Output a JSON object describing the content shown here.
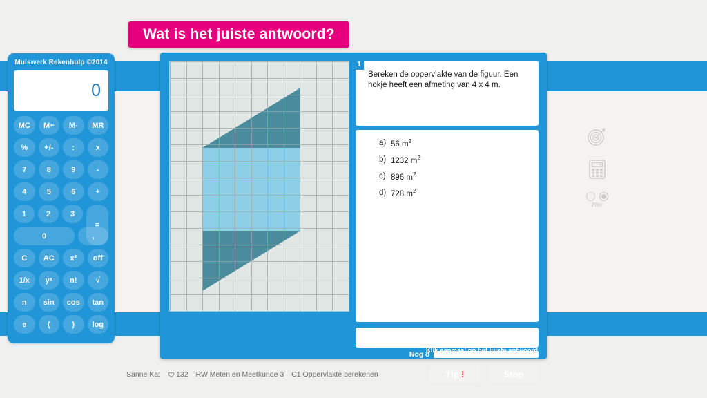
{
  "banner": {
    "title": "Wat is het juiste antwoord?"
  },
  "calculator": {
    "title": "Muiswerk Rekenhulp ©2014",
    "display_value": "0",
    "rows": [
      {
        "keys": [
          {
            "label": "MC",
            "name": "calc-key-mc"
          },
          {
            "label": "M+",
            "name": "calc-key-m-plus"
          },
          {
            "label": "M-",
            "name": "calc-key-m-minus"
          },
          {
            "label": "MR",
            "name": "calc-key-mr"
          }
        ]
      },
      {
        "keys": [
          {
            "label": "%",
            "name": "calc-key-percent"
          },
          {
            "label": "+/-",
            "name": "calc-key-sign"
          },
          {
            "label": ":",
            "name": "calc-key-divide"
          },
          {
            "label": "x",
            "name": "calc-key-multiply"
          }
        ]
      },
      {
        "keys": [
          {
            "label": "7",
            "name": "calc-key-7"
          },
          {
            "label": "8",
            "name": "calc-key-8"
          },
          {
            "label": "9",
            "name": "calc-key-9"
          },
          {
            "label": "-",
            "name": "calc-key-subtract"
          }
        ]
      },
      {
        "keys": [
          {
            "label": "4",
            "name": "calc-key-4"
          },
          {
            "label": "5",
            "name": "calc-key-5"
          },
          {
            "label": "6",
            "name": "calc-key-6"
          },
          {
            "label": "+",
            "name": "calc-key-add"
          }
        ]
      },
      {
        "keys": [
          {
            "label": "1",
            "name": "calc-key-1"
          },
          {
            "label": "2",
            "name": "calc-key-2"
          },
          {
            "label": "3",
            "name": "calc-key-3"
          }
        ],
        "tall_key": {
          "label": "=",
          "name": "calc-key-equals"
        }
      },
      {
        "keys": [
          {
            "label": "0",
            "name": "calc-key-0",
            "wide": true
          },
          {
            "label": ",",
            "name": "calc-key-comma"
          }
        ]
      },
      {
        "keys": [
          {
            "label": "C",
            "name": "calc-key-clear"
          },
          {
            "label": "AC",
            "name": "calc-key-all-clear"
          },
          {
            "label": "x²",
            "name": "calc-key-square"
          },
          {
            "label": "off",
            "name": "calc-key-off"
          }
        ]
      },
      {
        "keys": [
          {
            "label": "1/x",
            "name": "calc-key-reciprocal"
          },
          {
            "label": "yˣ",
            "name": "calc-key-power"
          },
          {
            "label": "n!",
            "name": "calc-key-factorial"
          },
          {
            "label": "√",
            "name": "calc-key-sqrt"
          }
        ]
      },
      {
        "keys": [
          {
            "label": "n",
            "name": "calc-key-pi"
          },
          {
            "label": "sin",
            "name": "calc-key-sin"
          },
          {
            "label": "cos",
            "name": "calc-key-cos"
          },
          {
            "label": "tan",
            "name": "calc-key-tan"
          }
        ]
      },
      {
        "keys": [
          {
            "label": "e",
            "name": "calc-key-e"
          },
          {
            "label": "(",
            "name": "calc-key-paren-open"
          },
          {
            "label": ")",
            "name": "calc-key-paren-close"
          },
          {
            "label": "log",
            "name": "calc-key-log"
          }
        ]
      }
    ]
  },
  "exercise": {
    "question_number": "1",
    "question_text": "Bereken de oppervlakte van de figuur. Een hokje heeft een afmeting van 4 x 4 m.",
    "answers": [
      {
        "letter": "a)",
        "value": "56 m²"
      },
      {
        "letter": "b)",
        "value": "1232 m²"
      },
      {
        "letter": "c)",
        "value": "896 m²"
      },
      {
        "letter": "d)",
        "value": "728 m²"
      }
    ],
    "answer_input_value": "",
    "progress_label": "Nog 8",
    "tip_button": "Tip",
    "tip_marker": "!",
    "stop_button": "Stop",
    "hint_text": "Klik eenmaal op het juiste antwoord"
  },
  "figure": {
    "grid_columns": 11,
    "grid_rows": 15,
    "cell_meters": "4 x 4 m",
    "fill_light": "#8ecfe8",
    "fill_dark": "#4a8c9e",
    "grid_bg": "#dfe6e4",
    "grid_line": "#9aa8a5"
  },
  "tools": {
    "target_icon": "target-icon",
    "calculator_icon": "calculator-icon",
    "filter_label": "filter",
    "filter_selected_index": 1
  },
  "status": {
    "user_name": "Sanne Kat",
    "score_icon": "heart-icon",
    "score": "132",
    "course": "RW Meten en Meetkunde 3",
    "lesson": "C1 Oppervlakte berekenen"
  },
  "colors": {
    "brand_blue": "#2096d8",
    "banner_pink": "#e6007e",
    "tip_red": "#ff4040"
  }
}
